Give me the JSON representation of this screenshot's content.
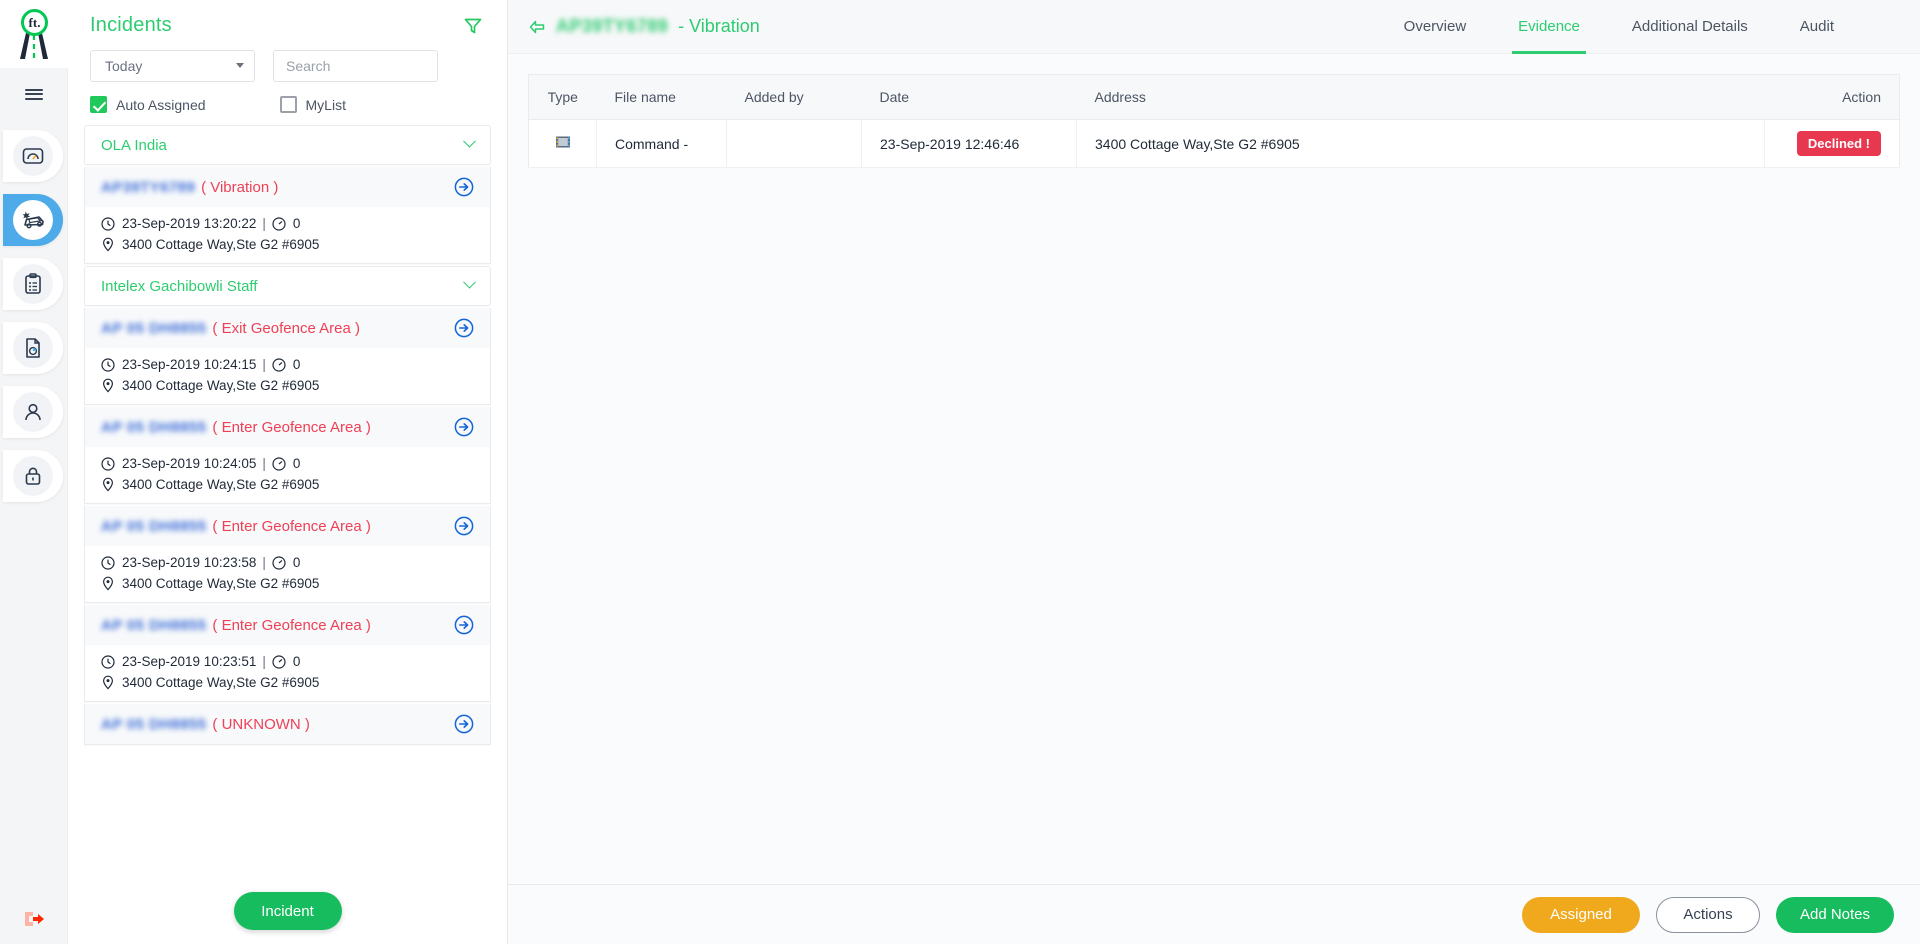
{
  "rail": {
    "logo_text": "ft.",
    "menu_label": "Menu",
    "items": [
      {
        "icon": "dashboard-gauge-icon",
        "name": "dashboard",
        "active": false
      },
      {
        "icon": "incident-car-alert-icon",
        "name": "incidents",
        "active": true
      },
      {
        "icon": "clipboard-tasks-icon",
        "name": "tasks",
        "active": false
      },
      {
        "icon": "report-document-icon",
        "name": "reports",
        "active": false
      },
      {
        "icon": "user-profile-icon",
        "name": "users",
        "active": false
      },
      {
        "icon": "lock-security-icon",
        "name": "security",
        "active": false
      }
    ],
    "logout_icon": "logout-icon"
  },
  "incident_panel": {
    "title": "Incidents",
    "filter_icon": "filter-funnel-icon",
    "date_filter": {
      "value": "Today",
      "caret_icon": "chevron-down-icon"
    },
    "search": {
      "value": "",
      "placeholder": "Search"
    },
    "checkboxes": [
      {
        "label": "Auto Assigned",
        "checked": true
      },
      {
        "label": "MyList",
        "checked": false
      }
    ],
    "fab_label": "Incident",
    "groups": [
      {
        "name": "OLA India",
        "incidents": [
          {
            "vehicle": "AP39TY6789",
            "type": "( Vibration )",
            "datetime": "23-Sep-2019 13:20:22",
            "separator": "|",
            "count": "0",
            "address": "3400 Cottage Way,Ste G2 #6905"
          }
        ]
      },
      {
        "name": "Intelex Gachibowli Staff",
        "incidents": [
          {
            "vehicle": "AP 05 DH8855",
            "type": "( Exit Geofence Area )",
            "datetime": "23-Sep-2019 10:24:15",
            "separator": "|",
            "count": "0",
            "address": "3400 Cottage Way,Ste G2 #6905"
          },
          {
            "vehicle": "AP 05 DH8855",
            "type": "( Enter Geofence Area )",
            "datetime": "23-Sep-2019 10:24:05",
            "separator": "|",
            "count": "0",
            "address": "3400 Cottage Way,Ste G2 #6905"
          },
          {
            "vehicle": "AP 05 DH8855",
            "type": "( Enter Geofence Area )",
            "datetime": "23-Sep-2019 10:23:58",
            "separator": "|",
            "count": "0",
            "address": "3400 Cottage Way,Ste G2 #6905"
          },
          {
            "vehicle": "AP 05 DH8855",
            "type": "( Enter Geofence Area )",
            "datetime": "23-Sep-2019 10:23:51",
            "separator": "|",
            "count": "0",
            "address": "3400 Cottage Way,Ste G2 #6905"
          },
          {
            "vehicle": "AP 05 DH8855",
            "type": "( UNKNOWN )",
            "datetime": "",
            "separator": "",
            "count": "",
            "address": ""
          }
        ]
      }
    ]
  },
  "detail": {
    "back_icon": "back-arrow-icon",
    "vehicle": "AP39TY6789",
    "title_suffix": "- Vibration",
    "tabs": [
      {
        "label": "Overview",
        "active": false
      },
      {
        "label": "Evidence",
        "active": true
      },
      {
        "label": "Additional Details",
        "active": false
      },
      {
        "label": "Audit",
        "active": false
      }
    ],
    "table": {
      "columns": [
        "Type",
        "File name",
        "Added by",
        "Date",
        "Address",
        "Action"
      ],
      "rows": [
        {
          "type_icon": "video-film-icon",
          "file_name": "Command -",
          "added_by": "",
          "date": "23-Sep-2019 12:46:46",
          "address": "3400 Cottage Way,Ste G2 #6905",
          "action_label": "Declined !"
        }
      ]
    },
    "footer_buttons": {
      "assigned": "Assigned",
      "actions": "Actions",
      "add_notes": "Add Notes"
    }
  },
  "colors": {
    "brand_green": "#2ecc71",
    "accent_blue": "#4eabe9",
    "danger_red": "#e8384f",
    "warning_orange": "#f0a91c",
    "incident_type_red": "#ef4056"
  }
}
